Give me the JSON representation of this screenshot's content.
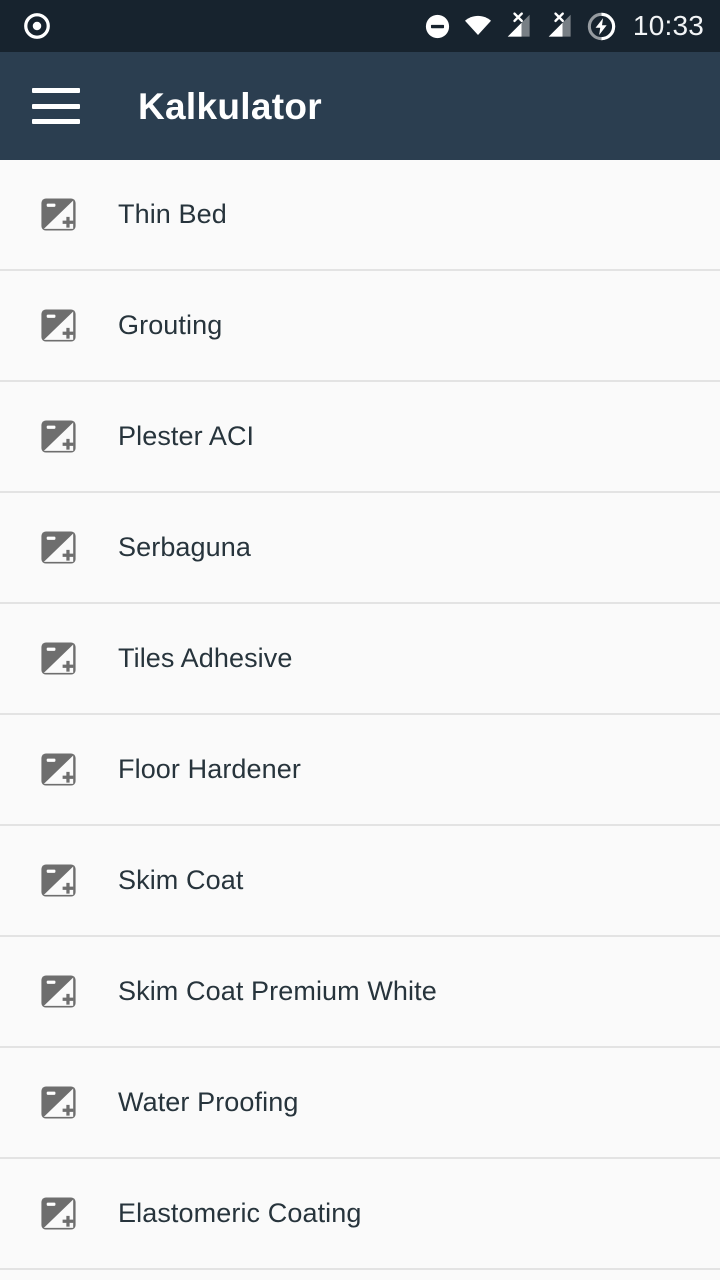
{
  "status_bar": {
    "background": "#17232e",
    "time": "10:33",
    "left_icons": [
      {
        "name": "record-notification-icon",
        "glyph": "target-circle"
      }
    ],
    "right_icons": [
      {
        "name": "do-not-disturb-icon",
        "glyph": "circle-minus"
      },
      {
        "name": "wifi-icon",
        "glyph": "wifi-full"
      },
      {
        "name": "cellular-signal-1-icon",
        "glyph": "signal-no-sim"
      },
      {
        "name": "cellular-signal-2-icon",
        "glyph": "signal-no-sim"
      },
      {
        "name": "battery-charging-icon",
        "glyph": "circle-bolt"
      }
    ]
  },
  "app_bar": {
    "background": "#2b3e50",
    "title": "Kalkulator",
    "menu_icon_name": "hamburger-menu-icon"
  },
  "list": {
    "background": "#fafafa",
    "divider_color": "#e3e3e3",
    "item_icon_name": "image-placeholder-icon",
    "items": [
      {
        "label": "Thin Bed"
      },
      {
        "label": "Grouting"
      },
      {
        "label": "Plester ACI"
      },
      {
        "label": "Serbaguna"
      },
      {
        "label": "Tiles Adhesive"
      },
      {
        "label": "Floor Hardener"
      },
      {
        "label": "Skim Coat"
      },
      {
        "label": "Skim Coat Premium White"
      },
      {
        "label": "Water Proofing"
      },
      {
        "label": "Elastomeric Coating"
      }
    ]
  }
}
